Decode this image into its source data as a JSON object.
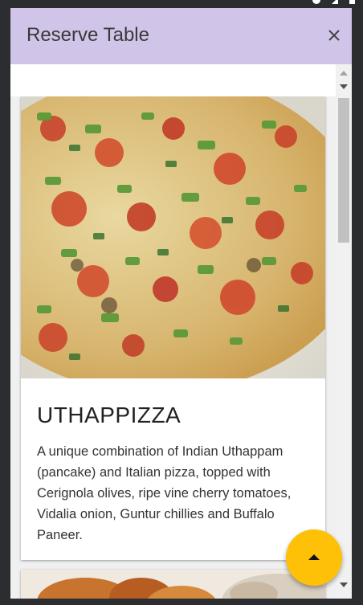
{
  "dialog": {
    "title": "Reserve Table",
    "close_icon": "close-icon"
  },
  "dishes": [
    {
      "name": "UTHAPPIZZA",
      "description": "A unique combination of Indian Uthappam (pancake) and Italian pizza, topped with Cerignola olives, ripe vine cherry tomatoes, Vidalia onion, Guntur chillies and Buffalo Paneer.",
      "image": "uthappizza-photo"
    },
    {
      "image": "dish-photo"
    }
  ],
  "fab": {
    "icon": "arrow-up-icon",
    "color": "#ffc107"
  },
  "colors": {
    "header": "#d0c4e8",
    "accent": "#ffc107"
  }
}
